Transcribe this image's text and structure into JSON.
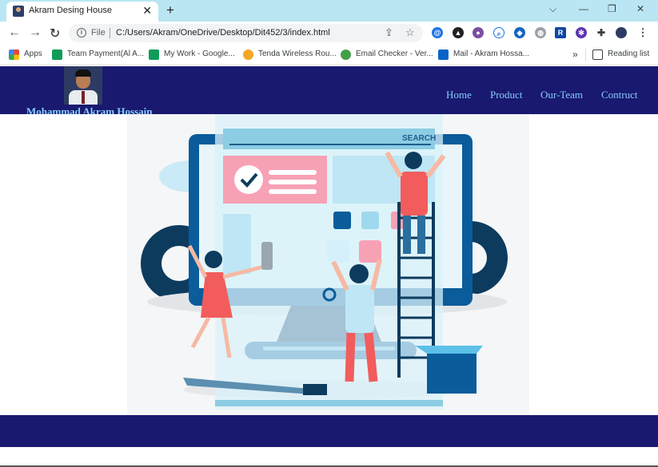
{
  "browser": {
    "tab": {
      "title": "Akram Desing House"
    },
    "address_bar": {
      "scheme_label": "File",
      "url": "C:/Users/Akram/OneDrive/Desktop/Dit452/3/index.html"
    },
    "bookmarks": [
      {
        "label": "Apps",
        "icon": "apps-grid-icon",
        "color": "#ea4335"
      },
      {
        "label": "Team Payment(Al A...",
        "icon": "google-sheets-icon",
        "color": "#0f9d58"
      },
      {
        "label": "My Work - Google...",
        "icon": "google-sheets-icon",
        "color": "#0f9d58"
      },
      {
        "label": "Tenda Wireless Rou...",
        "icon": "tenda-icon",
        "color": "#f5a623"
      },
      {
        "label": "Email Checker - Ver...",
        "icon": "check-circle-icon",
        "color": "#43a047"
      },
      {
        "label": "Mail - Akram Hossa...",
        "icon": "outlook-icon",
        "color": "#0a64c8"
      }
    ],
    "overflow_label": "»",
    "reading_list_label": "Reading list"
  },
  "site": {
    "brand_name": "Mohammad Akram Hossain",
    "nav": [
      {
        "label": "Home"
      },
      {
        "label": "Product"
      },
      {
        "label": "Our-Team"
      },
      {
        "label": "Contruct"
      }
    ],
    "hero": {
      "search_label": "SEARCH",
      "icon": "web-design-illustration"
    }
  },
  "colors": {
    "header_bg": "#191970",
    "nav_text": "#87cefa",
    "tabstrip_bg": "#b9e6f2"
  }
}
